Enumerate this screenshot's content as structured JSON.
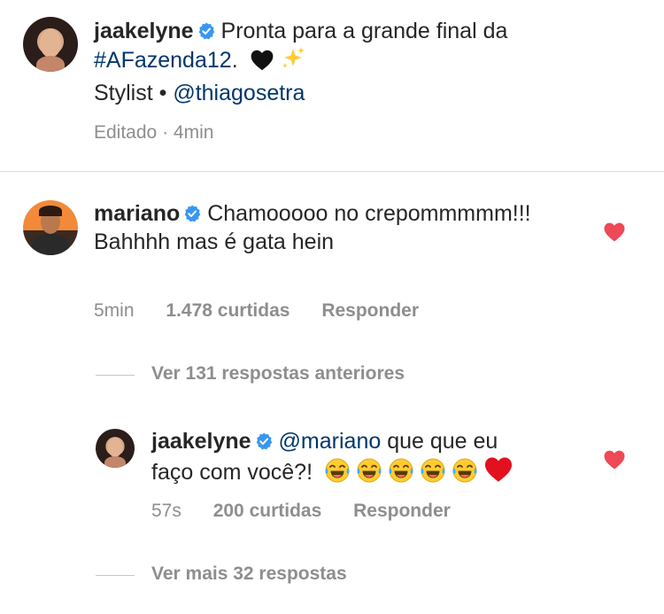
{
  "caption": {
    "username": "jaakelyne",
    "text_before": "Pronta para a grande final da",
    "hashtag": "#AFazenda12",
    "text_after": ".",
    "line2_prefix": "Stylist • ",
    "mention": "@thiagosetra",
    "edited": "Editado",
    "dot": "·",
    "time": "4min"
  },
  "comment": {
    "username": "mariano",
    "text": "Chamooooo no crepommmmm!!! Bahhhh mas é gata hein",
    "time": "5min",
    "likes": "1.478 curtidas",
    "reply_label": "Responder",
    "view_previous": "Ver 131 respostas anteriores"
  },
  "reply": {
    "username": "jaakelyne",
    "mention": "@mariano",
    "text_line1": "que que eu",
    "text_line2": "faço com você?!",
    "time": "57s",
    "likes": "200 curtidas",
    "reply_label": "Responder",
    "view_more": "Ver mais 32 respostas"
  },
  "colors": {
    "link": "#00376b",
    "heart": "#ed4956",
    "verified": "#3897f0",
    "meta": "#8e8e8e"
  },
  "icons": [
    "verified-badge-icon",
    "black-heart-emoji",
    "sparkles-emoji",
    "laughing-tears-emoji",
    "red-heart-emoji",
    "like-heart-icon"
  ]
}
